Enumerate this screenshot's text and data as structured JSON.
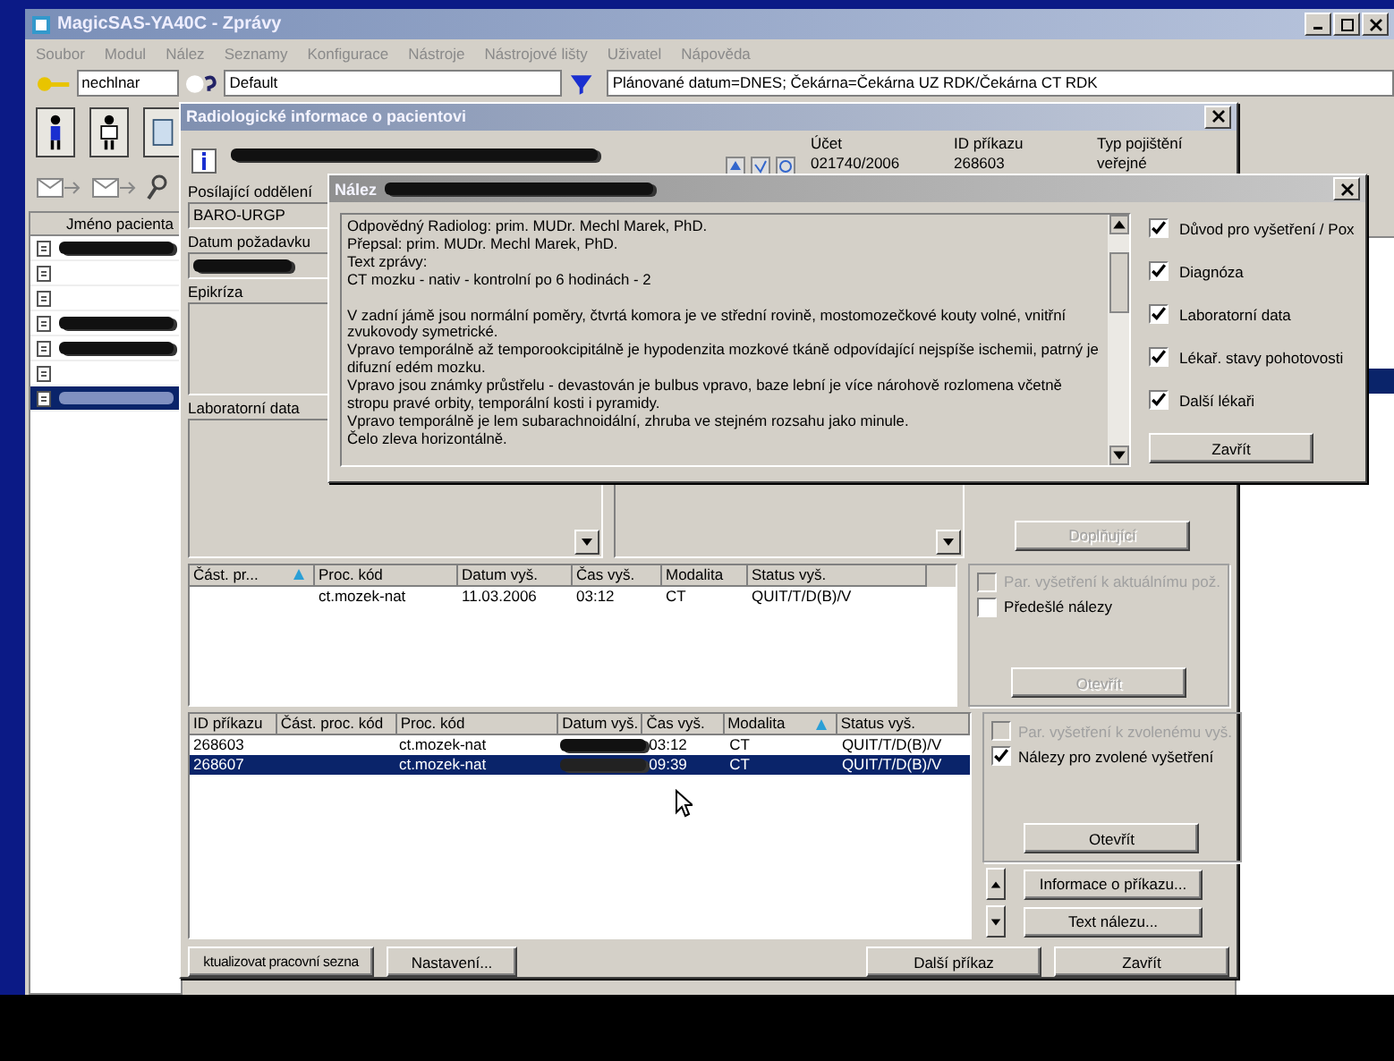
{
  "main_window": {
    "title": "MagicSAS-YA40C - Zprávy",
    "menu": [
      "Soubor",
      "Modul",
      "Nález",
      "Seznamy",
      "Konfigurace",
      "Nástroje",
      "Nástrojové lišty",
      "Uživatel",
      "Nápověda"
    ],
    "user_field": {
      "value": "nechlnar"
    },
    "profile_field": {
      "value": "Default"
    },
    "filter_field": {
      "value": "Plánované datum=DNES; Čekárna=Čekárna UZ RDK/Čekárna CT RDK"
    },
    "patient_list": {
      "column": "Jméno pacienta",
      "rows": [
        {
          "redacted": true,
          "selected": false
        },
        {
          "redacted": false,
          "selected": false
        },
        {
          "redacted": false,
          "selected": false
        },
        {
          "redacted": true,
          "selected": false
        },
        {
          "redacted": true,
          "selected": false
        },
        {
          "redacted": false,
          "selected": false
        },
        {
          "redacted": true,
          "selected": true
        }
      ]
    }
  },
  "patient_dialog": {
    "title": "Radiologické informace o pacientovi",
    "account": [
      {
        "label": "Účet",
        "value": "021740/2006"
      },
      {
        "label": "ID příkazu",
        "value": "268603"
      },
      {
        "label": "Typ pojištění",
        "value": "veřejné"
      }
    ],
    "referring_department": {
      "label": "Posílající oddělení",
      "value": "BARO-URGP"
    },
    "request_date": {
      "label": "Datum požadavku"
    },
    "epicrisis": {
      "label": "Epikríza"
    },
    "lab_data": {
      "label": "Laboratorní data"
    },
    "supplement_button": {
      "label": "Doplňující",
      "disabled": true
    },
    "upper_checks": [
      {
        "label": "Par. vyšetření k aktuálnímu pož.",
        "checked": false,
        "disabled": true
      },
      {
        "label": "Předešlé nálezy",
        "checked": false,
        "disabled": false
      }
    ],
    "upper_open_button": {
      "label": "Otevřít",
      "disabled": true
    },
    "exam_table": {
      "columns": [
        {
          "label": "Část. pr...",
          "sorted": true
        },
        {
          "label": "Proc. kód",
          "sorted": false
        },
        {
          "label": "Datum vyš.",
          "sorted": false
        },
        {
          "label": "Čas vyš.",
          "sorted": false
        },
        {
          "label": "Modalita",
          "sorted": false
        },
        {
          "label": "Status vyš.",
          "sorted": false
        }
      ],
      "rows": [
        {
          "selected": false,
          "cells": [
            "",
            "ct.mozek-nat",
            "11.03.2006",
            "03:12",
            "CT",
            "QUIT/T/D(B)/V"
          ]
        }
      ]
    },
    "order_table": {
      "columns": [
        {
          "label": "ID příkazu",
          "sorted": false
        },
        {
          "label": "Část. proc. kód",
          "sorted": false
        },
        {
          "label": "Proc. kód",
          "sorted": false
        },
        {
          "label": "Datum vyš.",
          "sorted": false
        },
        {
          "label": "Čas vyš.",
          "sorted": false
        },
        {
          "label": "Modalita",
          "sorted": true
        },
        {
          "label": "Status vyš.",
          "sorted": false
        }
      ],
      "rows": [
        {
          "selected": false,
          "cells": [
            "268603",
            "",
            "ct.mozek-nat",
            null,
            "03:12",
            "CT",
            "QUIT/T/D(B)/V"
          ]
        },
        {
          "selected": true,
          "cells": [
            "268607",
            "",
            "ct.mozek-nat",
            null,
            "09:39",
            "CT",
            "QUIT/T/D(B)/V"
          ]
        }
      ]
    },
    "lower_checks": [
      {
        "label": "Par. vyšetření k zvolenému vyš.",
        "checked": false,
        "disabled": true
      },
      {
        "label": "Nálezy pro zvolené vyšetření",
        "checked": true,
        "disabled": false
      }
    ],
    "lower_open_button": {
      "label": "Otevřít",
      "disabled": false
    },
    "info_button": {
      "label": "Informace o příkazu..."
    },
    "text_button": {
      "label": "Text nálezu..."
    },
    "bottom_buttons": [
      "ktualizovat pracovní sezna",
      "Nastavení...",
      "Další příkaz",
      "Zavřít"
    ]
  },
  "report_dialog": {
    "title": "Nález",
    "header_lines": [
      "Odpovědný Radiolog: prim. MUDr. Mechl Marek, PhD.",
      "Přepsal: prim. MUDr. Mechl Marek, PhD.",
      "Text zprávy:",
      "CT mozku - nativ - kontrolní po 6 hodinách - 2"
    ],
    "body_lines": [
      "V zadní jámě jsou normální poměry, čtvrtá komora je ve střední rovině, mostomozečkové kouty volné, vnitřní zvukovody symetrické.",
      "Vpravo temporálně až temporookcipitálně je hypodenzita mozkové tkáně odpovídající nejspíše ischemii, patrný je difuzní edém mozku.",
      "Vpravo jsou známky průstřelu - devastován je bulbus vpravo, baze lební je více nárohově rozlomena včetně stropu pravé orbity, temporální kosti i pyramidy.",
      "Vpravo temporálně je lem subarachnoidální, zhruba ve stejném rozsahu jako minule.",
      "Čelo zleva horizontálně."
    ],
    "options": [
      {
        "label": "Důvod pro vyšetření / Pox",
        "checked": true
      },
      {
        "label": "Diagnóza",
        "checked": true
      },
      {
        "label": "Laboratorní data",
        "checked": true
      },
      {
        "label": "Lékař. stavy pohotovosti",
        "checked": true
      },
      {
        "label": "Další lékaři",
        "checked": true
      }
    ],
    "close_button": "Zavřít"
  }
}
